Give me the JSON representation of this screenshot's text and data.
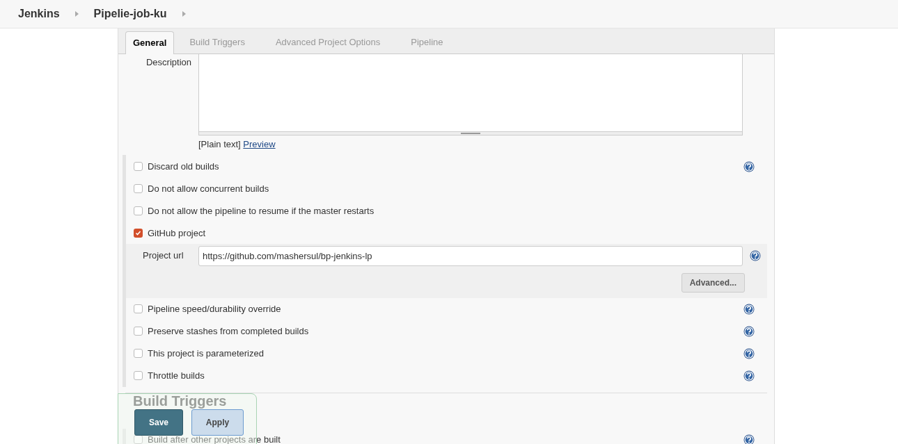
{
  "breadcrumbs": [
    {
      "label": "Jenkins"
    },
    {
      "label": "Pipelie-job-ku"
    }
  ],
  "tabs": [
    {
      "label": "General",
      "selected": true
    },
    {
      "label": "Build Triggers",
      "selected": false
    },
    {
      "label": "Advanced Project Options",
      "selected": false
    },
    {
      "label": "Pipeline",
      "selected": false
    }
  ],
  "description": {
    "label": "Description",
    "format_note": "[Plain text]",
    "preview_link": "Preview"
  },
  "options": [
    {
      "label": "Discard old builds",
      "checked": false,
      "help": true
    },
    {
      "label": "Do not allow concurrent builds",
      "checked": false,
      "help": false
    },
    {
      "label": "Do not allow the pipeline to resume if the master restarts",
      "checked": false,
      "help": false
    },
    {
      "label": "GitHub project",
      "checked": true,
      "help": false,
      "project_url": {
        "label": "Project url",
        "value": "https://github.com/mashersul/bp-jenkins-lp",
        "advanced_button": "Advanced..."
      }
    },
    {
      "label": "Pipeline speed/durability override",
      "checked": false,
      "help": true
    },
    {
      "label": "Preserve stashes from completed builds",
      "checked": false,
      "help": true
    },
    {
      "label": "This project is parameterized",
      "checked": false,
      "help": true
    },
    {
      "label": "Throttle builds",
      "checked": false,
      "help": true
    }
  ],
  "build_triggers": {
    "heading": "Build Triggers",
    "options": [
      {
        "label": "Build after other projects are built",
        "checked": false,
        "help": true
      }
    ]
  },
  "action_bar": {
    "buttons": [
      {
        "label": "Save",
        "kind": "primary"
      },
      {
        "label": "Apply",
        "kind": "secondary"
      }
    ]
  }
}
